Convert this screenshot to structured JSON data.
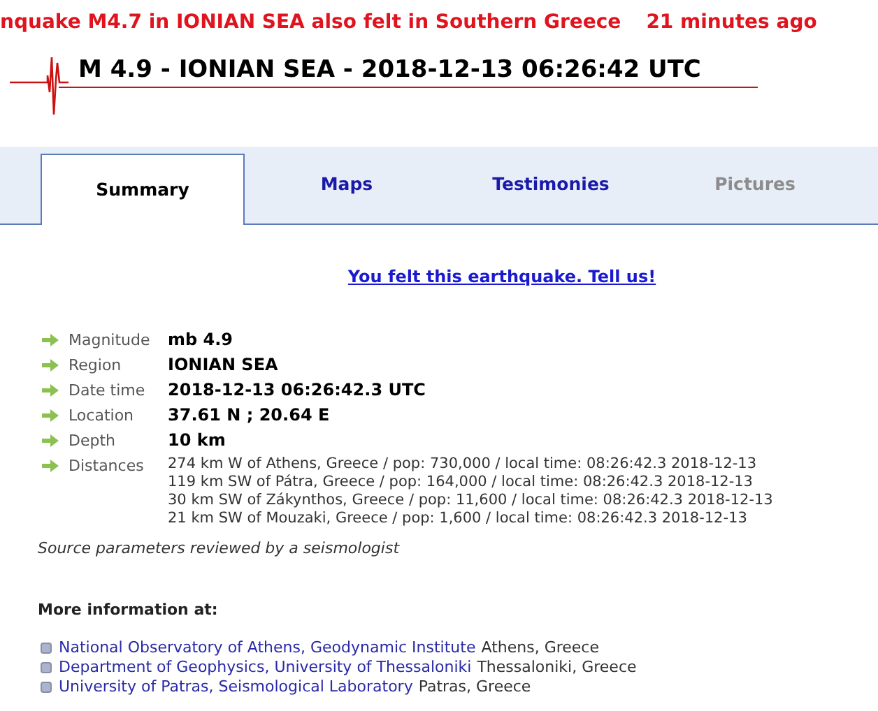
{
  "ticker": {
    "headline": "nquake M4.7 in IONIAN SEA also felt in Southern Greece",
    "age": "21 minutes ago"
  },
  "title": "M 4.9 - IONIAN SEA - 2018-12-13 06:26:42 UTC",
  "tabs": [
    {
      "label": "Summary",
      "selected": true,
      "disabled": false
    },
    {
      "label": "Maps",
      "selected": false,
      "disabled": false
    },
    {
      "label": "Testimonies",
      "selected": false,
      "disabled": false
    },
    {
      "label": "Pictures",
      "selected": false,
      "disabled": true
    }
  ],
  "felt_link": "You felt this earthquake. Tell us!",
  "parameters": [
    {
      "label": "Magnitude",
      "values": [
        "mb 4.9"
      ],
      "kind": "bold"
    },
    {
      "label": "Region",
      "values": [
        "IONIAN SEA"
      ],
      "kind": "bold"
    },
    {
      "label": "Date time",
      "values": [
        "2018-12-13 06:26:42.3 UTC"
      ],
      "kind": "bold"
    },
    {
      "label": "Location",
      "values": [
        "37.61 N ; 20.64 E"
      ],
      "kind": "bold"
    },
    {
      "label": "Depth",
      "values": [
        "10 km"
      ],
      "kind": "bold"
    },
    {
      "label": "Distances",
      "kind": "plain",
      "values": [
        "274 km W of Athens, Greece / pop: 730,000 / local time: 08:26:42.3 2018-12-13",
        "119 km SW of Pátra, Greece / pop: 164,000 / local time: 08:26:42.3 2018-12-13",
        "30 km SW of Zákynthos, Greece / pop: 11,600 / local time: 08:26:42.3 2018-12-13",
        "21 km SW of Mouzaki, Greece / pop: 1,600 / local time: 08:26:42.3 2018-12-13"
      ]
    }
  ],
  "review_note": "Source parameters reviewed by a seismologist",
  "more_info": {
    "heading": "More information at:",
    "links": [
      {
        "name": "National Observatory of Athens, Geodynamic Institute",
        "place": "Athens, Greece"
      },
      {
        "name": "Department of Geophysics, University of Thessaloniki",
        "place": "Thessaloniki, Greece"
      },
      {
        "name": "University of Patras, Seismological Laboratory",
        "place": "Patras, Greece"
      }
    ]
  }
}
